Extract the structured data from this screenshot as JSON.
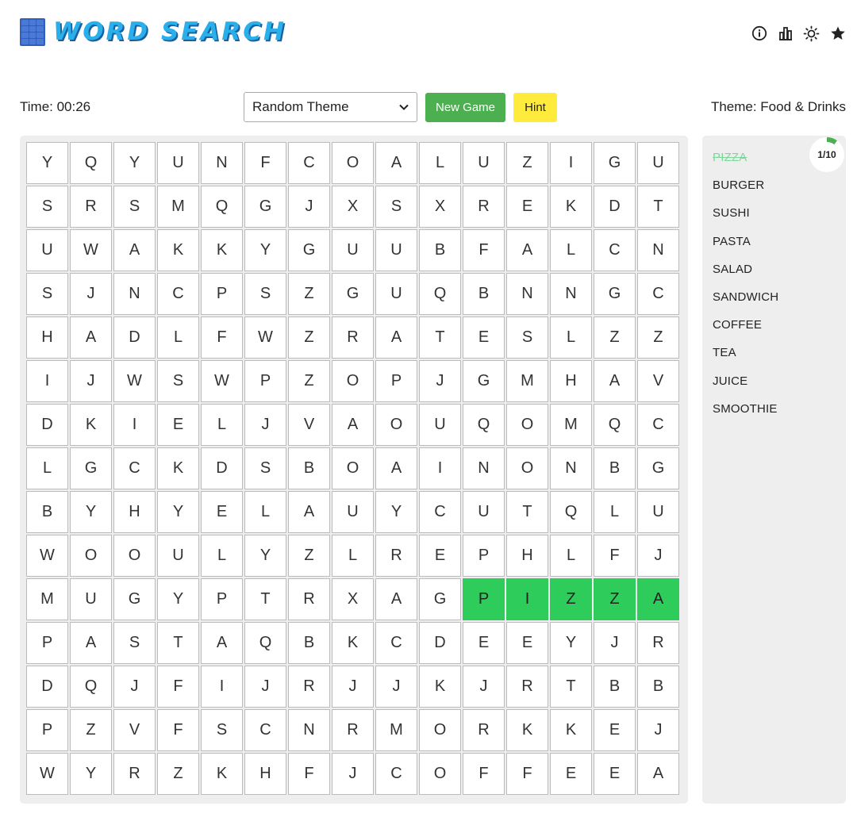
{
  "header": {
    "title": "WORD SEARCH",
    "icons": [
      "info-icon",
      "stats-icon",
      "sun-icon",
      "star-icon"
    ]
  },
  "controls": {
    "timer": "Time: 00:26",
    "theme_select_value": "Random Theme",
    "new_game_label": "New Game",
    "hint_label": "Hint",
    "theme_label": "Theme: Food & Drinks"
  },
  "grid": {
    "rows": [
      "YQYUNFCOALUZIGU",
      "SRSMQGJXSXREKDT",
      "UWAKKYGUUBFALCN",
      "SJNCPSZGUQBNNGC",
      "HADLFWZRATESLZZ",
      "IJWSWPZOPJGMHAV",
      "DKIELJVAOUQOMQC",
      "LGCKDSBOAINONBG",
      "BYHYELAUYCUTQLU",
      "WOOULYZLREPHLFJ",
      "MUGYPTRXAGPIZZA",
      "PASTAQBKCDEEYJR",
      "DQJFIJRJJKJRTBB",
      "PZVFSCNRMORKKEJ",
      "WYRZKHFJCOFFEEA"
    ],
    "found_cells": [
      [
        10,
        10
      ],
      [
        10,
        11
      ],
      [
        10,
        12
      ],
      [
        10,
        13
      ],
      [
        10,
        14
      ]
    ]
  },
  "words": [
    {
      "text": "PIZZA",
      "found": true
    },
    {
      "text": "BURGER",
      "found": false
    },
    {
      "text": "SUSHI",
      "found": false
    },
    {
      "text": "PASTA",
      "found": false
    },
    {
      "text": "SALAD",
      "found": false
    },
    {
      "text": "SANDWICH",
      "found": false
    },
    {
      "text": "COFFEE",
      "found": false
    },
    {
      "text": "TEA",
      "found": false
    },
    {
      "text": "JUICE",
      "found": false
    },
    {
      "text": "SMOOTHIE",
      "found": false
    }
  ],
  "progress": {
    "found": 1,
    "total": 10,
    "label": "1/10",
    "fill_color": "#4caf50"
  },
  "colors": {
    "accent_green": "#4caf50",
    "found_green": "#2ecc5b",
    "hint_yellow": "#ffeb3b",
    "logo_blue": "#29b0ea"
  }
}
